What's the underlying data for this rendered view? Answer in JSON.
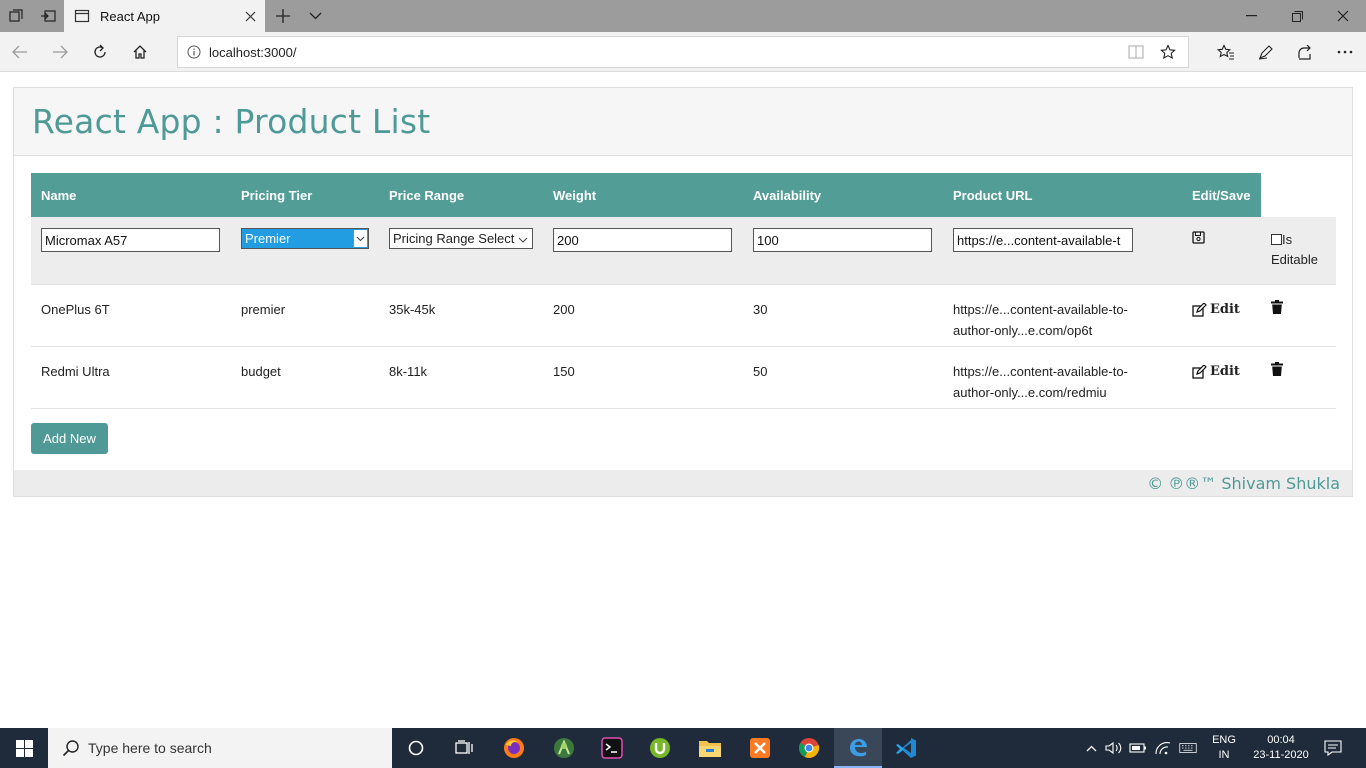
{
  "browser": {
    "tab_title": "React App",
    "url": "localhost:3000/"
  },
  "page": {
    "title": "React App : Product List",
    "footer": "© ℗®™ Shivam Shukla",
    "add_button": "Add New"
  },
  "table": {
    "headers": [
      "Name",
      "Pricing Tier",
      "Price Range",
      "Weight",
      "Availability",
      "Product URL",
      "Edit/Save"
    ],
    "edit_row": {
      "name": "Micromax A57",
      "tier": "Premier",
      "range": "Pricing Range Select",
      "weight": "200",
      "availability": "100",
      "url": "https://e...content-available-t",
      "checkbox_label_1": "Is",
      "checkbox_label_2": "Editable"
    },
    "rows": [
      {
        "name": "OnePlus 6T",
        "tier": "premier",
        "range": "35k-45k",
        "weight": "200",
        "availability": "30",
        "url_line1": "https://e...content-available-to-",
        "url_line2": "author-only...e.com/op6t",
        "edit": "Edit"
      },
      {
        "name": "Redmi Ultra",
        "tier": "budget",
        "range": "8k-11k",
        "weight": "150",
        "availability": "50",
        "url_line1": "https://e...content-available-to-",
        "url_line2": "author-only...e.com/redmiu",
        "edit": "Edit"
      }
    ]
  },
  "taskbar": {
    "search_placeholder": "Type here to search",
    "lang_line1": "ENG",
    "lang_line2": "IN",
    "time": "00:04",
    "date": "23-11-2020"
  },
  "colors": {
    "accent": "#4f9a96",
    "header_bg": "#529e97",
    "taskbar": "#1f2b3a"
  }
}
